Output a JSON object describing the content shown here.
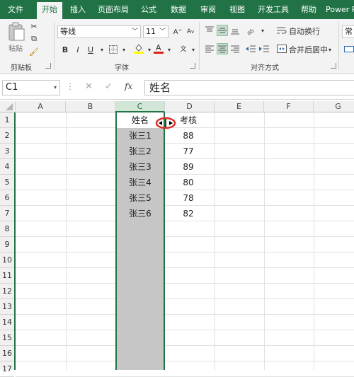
{
  "ribbon_tabs": [
    "文件",
    "开始",
    "插入",
    "页面布局",
    "公式",
    "数据",
    "审阅",
    "视图",
    "开发工具",
    "帮助",
    "Power P"
  ],
  "clipboard": {
    "paste_label": "粘贴",
    "group_label": "剪贴板"
  },
  "font": {
    "name": "等线",
    "size": "11",
    "group_label": "字体",
    "bold": "B",
    "italic": "I",
    "underline": "U"
  },
  "alignment": {
    "wrap_label": "自动换行",
    "merge_label": "合并后居中",
    "group_label": "对齐方式"
  },
  "number": {
    "format_label": "常规"
  },
  "formula_bar": {
    "name_box": "C1",
    "fx": "fx",
    "content": "姓名"
  },
  "columns": [
    "A",
    "B",
    "C",
    "D",
    "E",
    "F",
    "G"
  ],
  "rows": [
    "1",
    "2",
    "3",
    "4",
    "5",
    "6",
    "7",
    "8",
    "9",
    "10",
    "11",
    "12",
    "13",
    "14",
    "15",
    "16",
    "17"
  ],
  "table": {
    "headers": [
      "姓名",
      "考核"
    ],
    "records": [
      [
        "张三1",
        "88"
      ],
      [
        "张三2",
        "77"
      ],
      [
        "张三3",
        "89"
      ],
      [
        "张三4",
        "80"
      ],
      [
        "张三5",
        "78"
      ],
      [
        "张三6",
        "82"
      ]
    ]
  },
  "selected_column": "C",
  "colors": {
    "accent": "#217346",
    "selection_fill": "#c6c6c6",
    "cursor_highlight": "#d9302a"
  }
}
